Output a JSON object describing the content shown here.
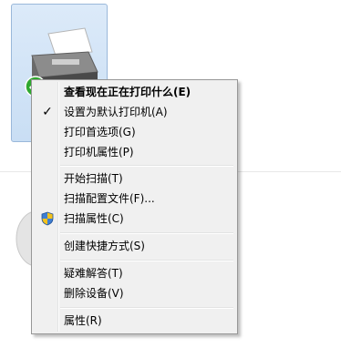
{
  "menu": {
    "items": [
      {
        "label": "查看现在正在打印什么(E)",
        "bold": true
      },
      {
        "label": "设置为默认打印机(A)",
        "checked": true
      },
      {
        "label": "打印首选项(G)"
      },
      {
        "label": "打印机属性(P)"
      },
      {
        "label": "开始扫描(T)"
      },
      {
        "label": "扫描配置文件(F)..."
      },
      {
        "label": "扫描属性(C)",
        "icon": "uac-shield-icon"
      },
      {
        "label": "创建快捷方式(S)"
      },
      {
        "label": "疑难解答(T)"
      },
      {
        "label": "删除设备(V)"
      },
      {
        "label": "属性(R)"
      }
    ]
  },
  "icons": {
    "check": "✓",
    "printer": "printer-icon",
    "default_badge": "default-check-badge-icon"
  },
  "colors": {
    "menu_bg": "#f0f0f0",
    "menu_border": "#979797",
    "tile_selected": "#cfe2f6",
    "badge_green": "#2fa82f"
  }
}
